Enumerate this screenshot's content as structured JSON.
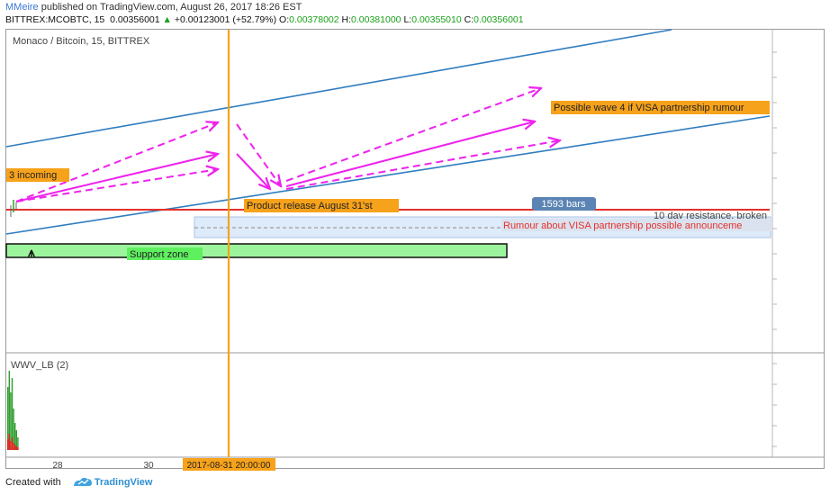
{
  "header": {
    "author": "MMeire",
    "published": " published on TradingView.com, August 26, 2017 18:26 EST",
    "symbol": "BITTREX:MCOBTC, 15",
    "price": "0.00356001",
    "change_arrow": "▲",
    "change": "+0.00123001 (+52.79%)",
    "o_label": "O:",
    "o_value": "0.00378002",
    "h_label": "H:",
    "h_value": "0.00381000",
    "l_label": "L:",
    "l_value": "0.00355010",
    "c_label": "C:",
    "c_value": "0.00356001"
  },
  "footer": {
    "created_with": "Created with",
    "brand": "TradingView"
  },
  "colors": {
    "channel": "#2f7dbf",
    "resistance": "#e5302a",
    "arrows": "#ee22ee",
    "support_fill": "#9cf59c",
    "vertical_line": "#f7a21b",
    "label_bg": "#f7a21b",
    "bars_badge": "#5b84b5"
  },
  "chart_data": {
    "type": "line",
    "title": "Monaco / Bitcoin, 15, BITTREX",
    "x_tick_labels": [
      "28",
      "30"
    ],
    "crosshair_date_label": "2017-08-31 20:00:00",
    "series": [],
    "indicator": {
      "title": "WWV_LB (2)",
      "type": "bar",
      "colors": [
        "#2e9e2e",
        "#e62020"
      ]
    },
    "annotations": {
      "incoming_label": "3 incoming",
      "product_release_label": "Product release August 31'st",
      "bars_badge": "1593 bars",
      "resistance_label": "10 day resistance, broken",
      "rumour_label": "Rumour about VISA partnership possible announceme",
      "wave4_label": "Possible wave 4 if VISA partnership rumour",
      "support_label": "Support zone"
    },
    "grid": false,
    "legend": "none"
  }
}
